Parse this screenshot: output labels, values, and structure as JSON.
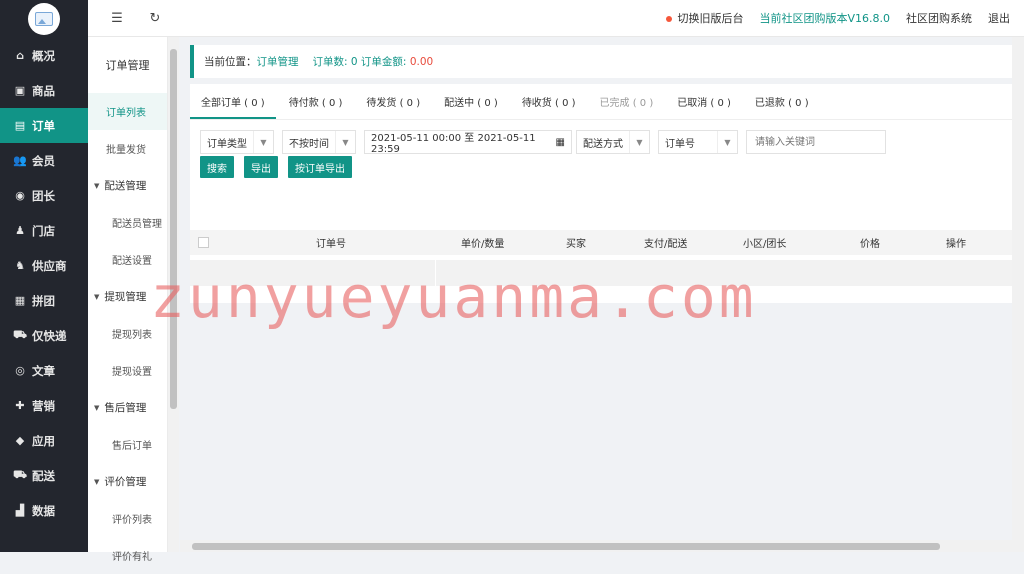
{
  "leftnav": {
    "items": [
      {
        "label": "概况",
        "icon": "home-icon",
        "glyph": "⌂"
      },
      {
        "label": "商品",
        "icon": "image-icon",
        "glyph": "▣"
      },
      {
        "label": "订单",
        "icon": "document-icon",
        "glyph": "▤",
        "active": true
      },
      {
        "label": "会员",
        "icon": "users-icon",
        "glyph": "👥"
      },
      {
        "label": "团长",
        "icon": "leader-icon",
        "glyph": "◉"
      },
      {
        "label": "门店",
        "icon": "store-icon",
        "glyph": "♟"
      },
      {
        "label": "供应商",
        "icon": "supplier-icon",
        "glyph": "♞"
      },
      {
        "label": "拼团",
        "icon": "grid-icon",
        "glyph": "▦"
      },
      {
        "label": "仅快递",
        "icon": "truck-icon",
        "glyph": "⛟"
      },
      {
        "label": "文章",
        "icon": "compass-icon",
        "glyph": "◎"
      },
      {
        "label": "营销",
        "icon": "gift-icon",
        "glyph": "✚"
      },
      {
        "label": "应用",
        "icon": "cube-icon",
        "glyph": "◆"
      },
      {
        "label": "配送",
        "icon": "delivery-icon",
        "glyph": "⛟"
      },
      {
        "label": "数据",
        "icon": "bar-chart-icon",
        "glyph": "▟"
      }
    ]
  },
  "topbar": {
    "switch_label": "切换旧版后台",
    "version": "当前社区团购版本V16.8.0",
    "system": "社区团购系统",
    "logout": "退出"
  },
  "subnav": {
    "title": "订单管理",
    "items": [
      {
        "label": "订单列表",
        "type": "item",
        "active": true
      },
      {
        "label": "批量发货",
        "type": "item"
      },
      {
        "label": "配送管理",
        "type": "section"
      },
      {
        "label": "配送员管理",
        "type": "child"
      },
      {
        "label": "配送设置",
        "type": "child"
      },
      {
        "label": "提现管理",
        "type": "section"
      },
      {
        "label": "提现列表",
        "type": "child"
      },
      {
        "label": "提现设置",
        "type": "child"
      },
      {
        "label": "售后管理",
        "type": "section"
      },
      {
        "label": "售后订单",
        "type": "child"
      },
      {
        "label": "评价管理",
        "type": "section"
      },
      {
        "label": "评价列表",
        "type": "child"
      },
      {
        "label": "评价有礼",
        "type": "child"
      }
    ]
  },
  "breadcrumb": {
    "prefix": "当前位置：",
    "current": "订单管理",
    "order_count_label": "订单数:",
    "order_count": "0",
    "order_amount_label": "订单金额:",
    "order_amount": "0.00"
  },
  "tabs": [
    {
      "label": "全部订单 ( 0 )",
      "active": true
    },
    {
      "label": "待付款 ( 0 )"
    },
    {
      "label": "待发货 ( 0 )"
    },
    {
      "label": "配送中 ( 0 )"
    },
    {
      "label": "待收货 ( 0 )"
    },
    {
      "label": "已完成 ( 0 )",
      "muted": true
    },
    {
      "label": "已取消 ( 0 )"
    },
    {
      "label": "已退款 ( 0 )"
    }
  ],
  "filters": {
    "order_type": "订单类型",
    "time_filter": "不按时间",
    "date_range": "2021-05-11 00:00 至 2021-05-11 23:59",
    "delivery_method": "配送方式",
    "search_field": "订单号",
    "keyword_placeholder": "请输入关键词"
  },
  "buttons": {
    "search": "搜索",
    "export": "导出",
    "export_by_order": "按订单导出"
  },
  "table": {
    "headers": [
      "订单号",
      "单价/数量",
      "买家",
      "支付/配送",
      "小区/团长",
      "价格",
      "操作"
    ]
  },
  "watermark": "zunyueyuanma.com",
  "colors": {
    "accent": "#119487",
    "sidebar": "#23262e",
    "highlight": "#e84c3d"
  }
}
